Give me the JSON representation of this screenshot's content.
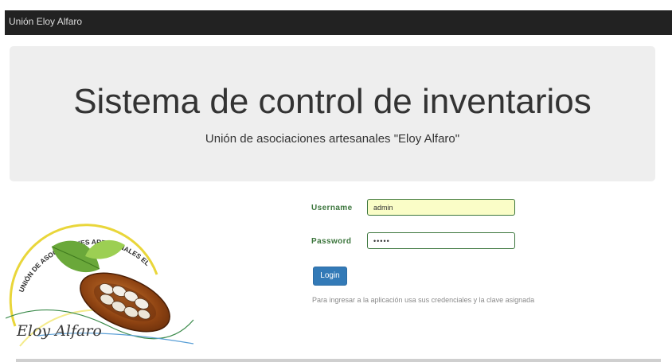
{
  "navbar": {
    "brand": "Unión Eloy Alfaro"
  },
  "jumbotron": {
    "title": "Sistema de control de inventarios",
    "subtitle": "Unión de asociaciones artesanales \"Eloy Alfaro\""
  },
  "logo": {
    "ring_text": "UNIÓN DE ASOCIACIONES ARTESANALES ELOY ALFARO",
    "signature": "Eloy Alfaro"
  },
  "login_form": {
    "username_label": "Username",
    "username_value": "admin",
    "password_label": "Password",
    "password_value": "•••••",
    "login_button": "Login",
    "help_text": "Para ingresar a la aplicación usa sus credenciales y la clave asignada"
  },
  "colors": {
    "navbar_bg": "#222222",
    "jumbotron_bg": "#eeeeee",
    "label_green": "#3c763d",
    "button_blue": "#337ab7",
    "username_bg": "#fafdc7"
  }
}
